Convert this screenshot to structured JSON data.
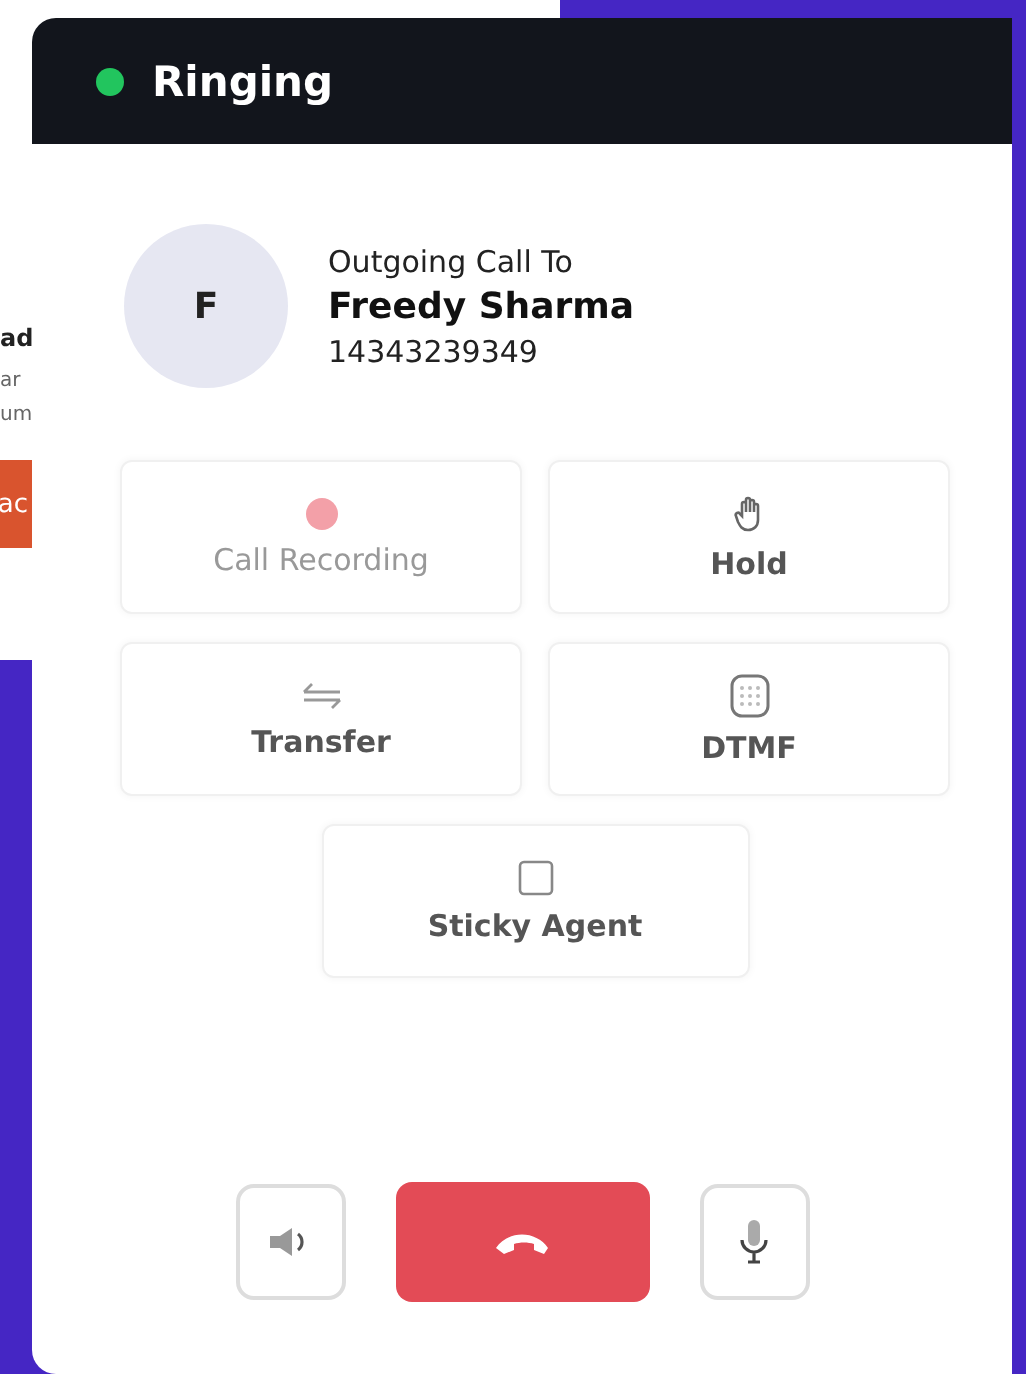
{
  "background_fragments": [
    "ad",
    "ar",
    "um",
    "ac"
  ],
  "header": {
    "status": "Ringing"
  },
  "caller": {
    "initial": "F",
    "caption": "Outgoing Call To",
    "name": "Freedy Sharma",
    "number": "14343239349"
  },
  "features": [
    {
      "kind": "record",
      "label": "Call Recording",
      "disabled": true
    },
    {
      "kind": "hold",
      "label": "Hold",
      "disabled": false
    },
    {
      "kind": "transfer",
      "label": "Transfer",
      "disabled": false
    },
    {
      "kind": "dtmf",
      "label": "DTMF",
      "disabled": false
    },
    {
      "kind": "sticky",
      "label": "Sticky Agent",
      "disabled": false
    }
  ],
  "controls": [
    {
      "kind": "speaker"
    },
    {
      "kind": "hangup"
    },
    {
      "kind": "mic"
    }
  ]
}
